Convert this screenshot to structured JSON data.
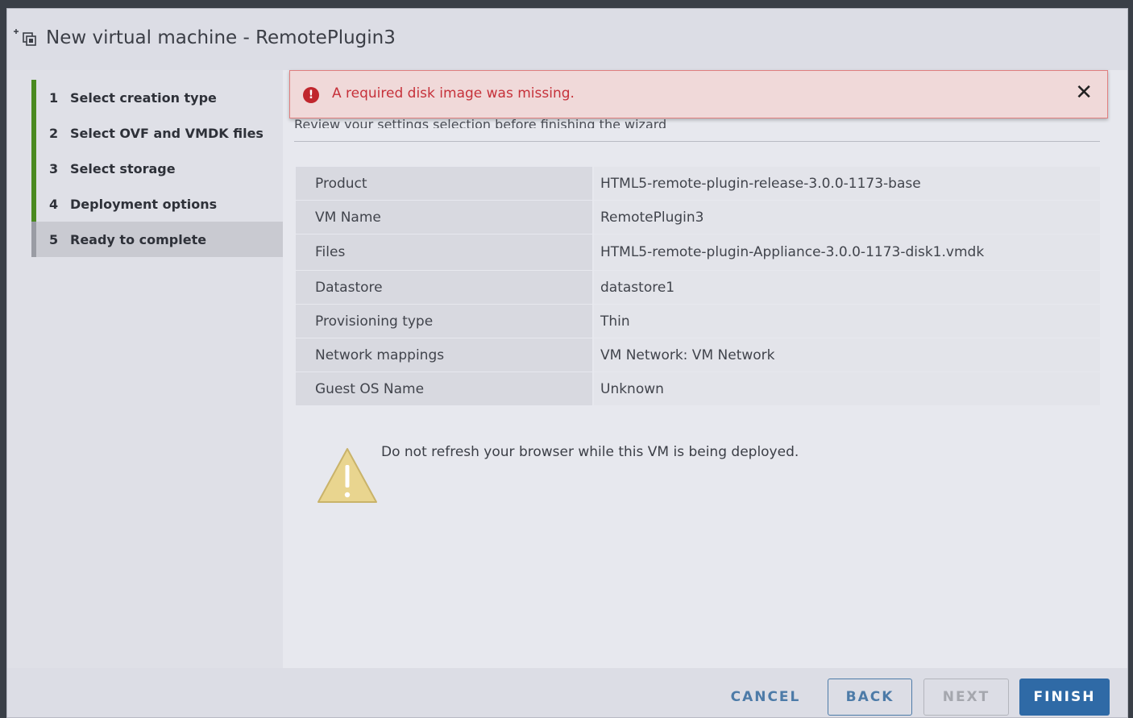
{
  "dialog": {
    "title": "New virtual machine - RemotePlugin3",
    "title_icon": "new-vm-icon"
  },
  "steps": [
    {
      "num": "1",
      "label": "Select creation type"
    },
    {
      "num": "2",
      "label": "Select OVF and VMDK files"
    },
    {
      "num": "3",
      "label": "Select storage"
    },
    {
      "num": "4",
      "label": "Deployment options"
    },
    {
      "num": "5",
      "label": "Ready to complete"
    }
  ],
  "alert": {
    "text": "A required disk image was missing.",
    "close": "✕",
    "icon": "error-icon",
    "color": "#c6313a"
  },
  "review": {
    "text": "Review your settings selection before finishing the wizard"
  },
  "summary": [
    {
      "key": "Product",
      "value": "HTML5-remote-plugin-release-3.0.0-1173-base"
    },
    {
      "key": "VM Name",
      "value": "RemotePlugin3"
    },
    {
      "key": "Files",
      "value": "HTML5-remote-plugin-Appliance-3.0.0-1173-disk1.vmdk"
    },
    {
      "key": "Datastore",
      "value": "datastore1"
    },
    {
      "key": "Provisioning type",
      "value": "Thin"
    },
    {
      "key": "Network mappings",
      "value": "VM Network: VM Network"
    },
    {
      "key": "Guest OS Name",
      "value": "Unknown"
    }
  ],
  "warning": {
    "text": "Do not refresh your browser while this VM is being deployed.",
    "icon": "warning-icon"
  },
  "buttons": {
    "cancel": "CANCEL",
    "back": "BACK",
    "next": "NEXT",
    "finish": "FINISH"
  },
  "colors": {
    "step_complete": "#4a8a20",
    "primary": "#2f6aa6"
  }
}
